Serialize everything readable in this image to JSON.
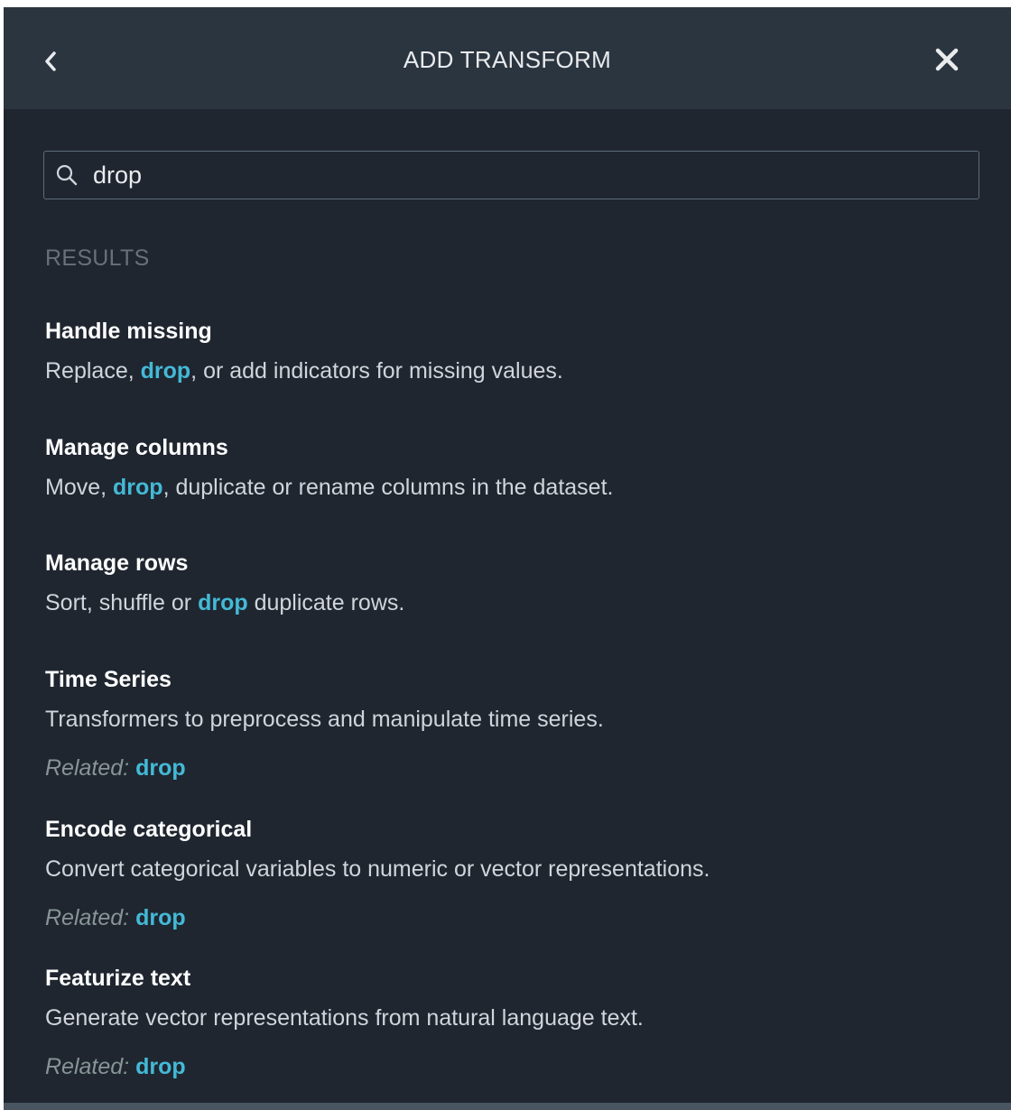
{
  "header": {
    "title": "ADD TRANSFORM",
    "back_icon": "chevron-left-icon",
    "close_icon": "close-icon"
  },
  "search": {
    "value": "drop",
    "icon": "search-icon"
  },
  "results_label": "RESULTS",
  "highlight_color": "#44b9d6",
  "results": [
    {
      "title": "Handle missing",
      "desc_before": "Replace, ",
      "desc_match": "drop",
      "desc_after": ", or add indicators for missing values."
    },
    {
      "title": "Manage columns",
      "desc_before": "Move, ",
      "desc_match": "drop",
      "desc_after": ", duplicate or rename columns in the dataset."
    },
    {
      "title": "Manage rows",
      "desc_before": "Sort, shuffle or ",
      "desc_match": "drop",
      "desc_after": " duplicate rows."
    },
    {
      "title": "Time Series",
      "description": "Transformers to preprocess and manipulate time series.",
      "related_label": "Related:",
      "related_value": "drop"
    },
    {
      "title": "Encode categorical",
      "description": "Convert categorical variables to numeric or vector representations.",
      "related_label": "Related:",
      "related_value": "drop"
    },
    {
      "title": "Featurize text",
      "description": "Generate vector representations from natural language text.",
      "related_label": "Related:",
      "related_value": "drop"
    }
  ]
}
